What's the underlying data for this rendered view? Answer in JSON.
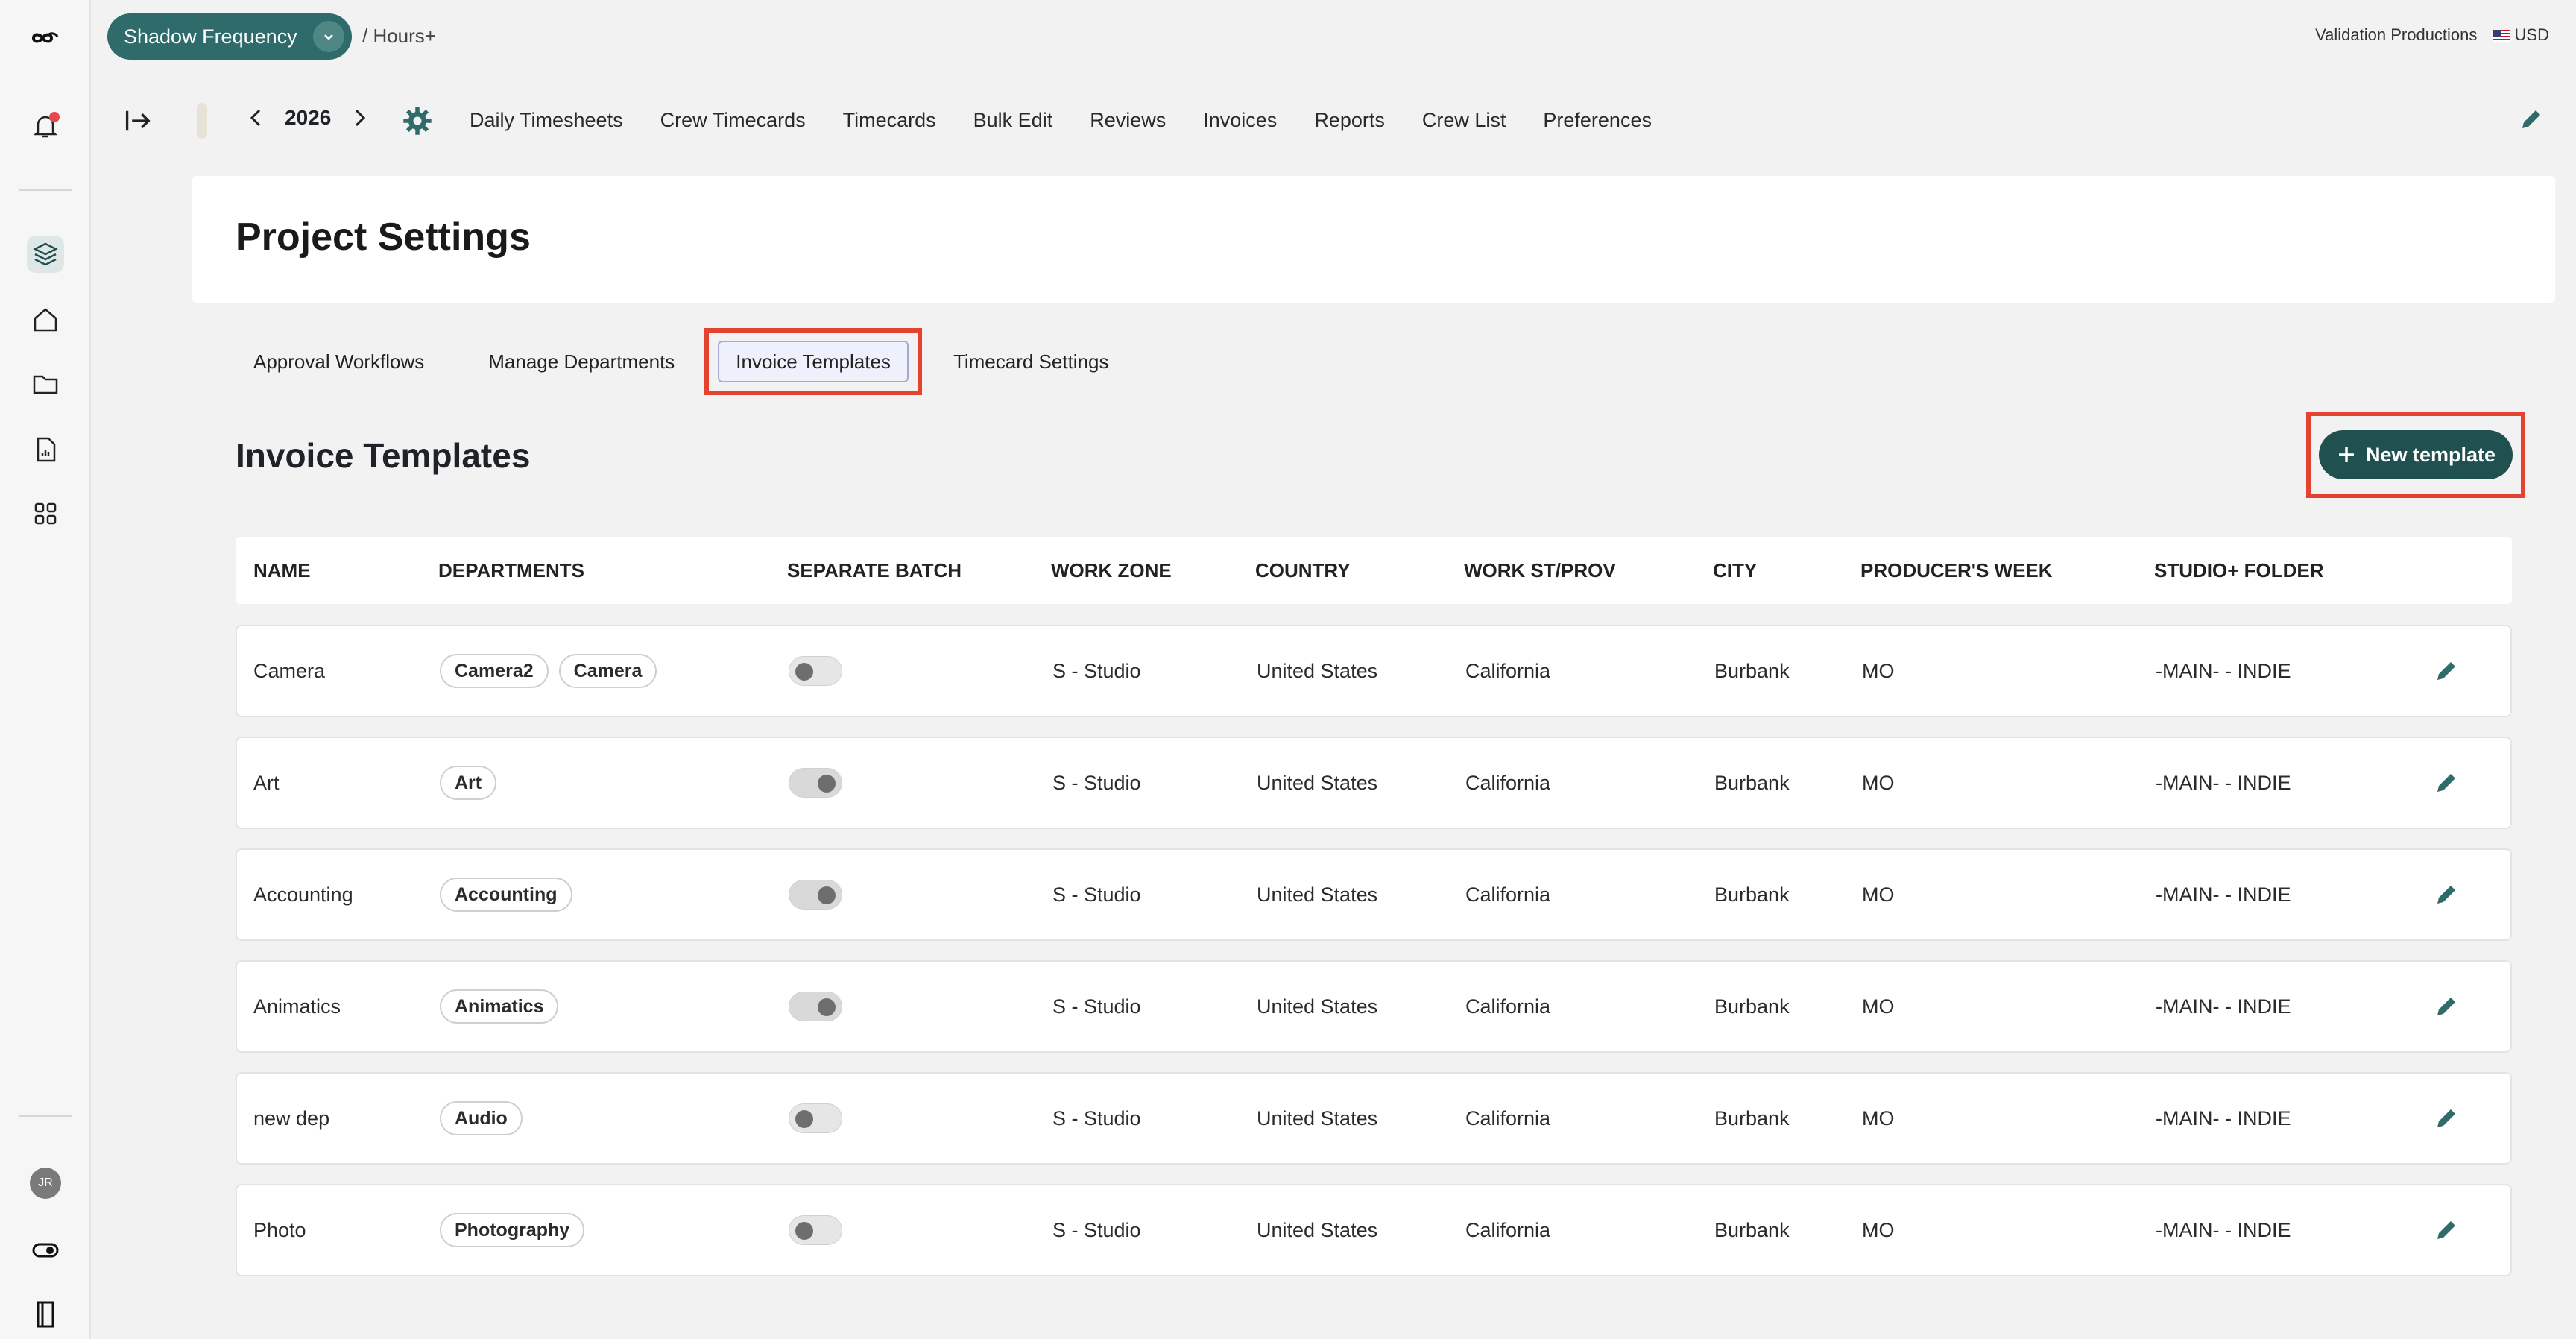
{
  "app": {
    "project_name": "Shadow Frequency",
    "breadcrumb": "/ Hours+",
    "company": "Validation Productions",
    "currency": "USD",
    "avatar_initials": "JR"
  },
  "nav": {
    "year": "2026",
    "links": [
      "Daily Timesheets",
      "Crew Timecards",
      "Timecards",
      "Bulk Edit",
      "Reviews",
      "Invoices",
      "Reports",
      "Crew List",
      "Preferences"
    ]
  },
  "page": {
    "title": "Project Settings",
    "tabs": [
      "Approval Workflows",
      "Manage Departments",
      "Invoice Templates",
      "Timecard Settings"
    ],
    "active_tab": "Invoice Templates",
    "section_title": "Invoice Templates",
    "new_button": "New template"
  },
  "table": {
    "headers": [
      "NAME",
      "DEPARTMENTS",
      "SEPARATE BATCH",
      "WORK ZONE",
      "COUNTRY",
      "WORK ST/PROV",
      "CITY",
      "PRODUCER'S WEEK",
      "STUDIO+ FOLDER"
    ],
    "rows": [
      {
        "name": "Camera",
        "departments": [
          "Camera2",
          "Camera"
        ],
        "separate_batch": false,
        "work_zone": "S - Studio",
        "country": "United States",
        "state": "California",
        "city": "Burbank",
        "producers_week": "MO",
        "folder": "-MAIN- - INDIE"
      },
      {
        "name": "Art",
        "departments": [
          "Art"
        ],
        "separate_batch": true,
        "work_zone": "S - Studio",
        "country": "United States",
        "state": "California",
        "city": "Burbank",
        "producers_week": "MO",
        "folder": "-MAIN- - INDIE"
      },
      {
        "name": "Accounting",
        "departments": [
          "Accounting"
        ],
        "separate_batch": true,
        "work_zone": "S - Studio",
        "country": "United States",
        "state": "California",
        "city": "Burbank",
        "producers_week": "MO",
        "folder": "-MAIN- - INDIE"
      },
      {
        "name": "Animatics",
        "departments": [
          "Animatics"
        ],
        "separate_batch": true,
        "work_zone": "S - Studio",
        "country": "United States",
        "state": "California",
        "city": "Burbank",
        "producers_week": "MO",
        "folder": "-MAIN- - INDIE"
      },
      {
        "name": "new dep",
        "departments": [
          "Audio"
        ],
        "separate_batch": false,
        "work_zone": "S - Studio",
        "country": "United States",
        "state": "California",
        "city": "Burbank",
        "producers_week": "MO",
        "folder": "-MAIN- - INDIE"
      },
      {
        "name": "Photo",
        "departments": [
          "Photography"
        ],
        "separate_batch": false,
        "work_zone": "S - Studio",
        "country": "United States",
        "state": "California",
        "city": "Burbank",
        "producers_week": "MO",
        "folder": "-MAIN- - INDIE"
      }
    ]
  },
  "colors": {
    "brand_teal": "#2e6b6a",
    "button_dark": "#20504f",
    "highlight_red": "#e4432f"
  }
}
